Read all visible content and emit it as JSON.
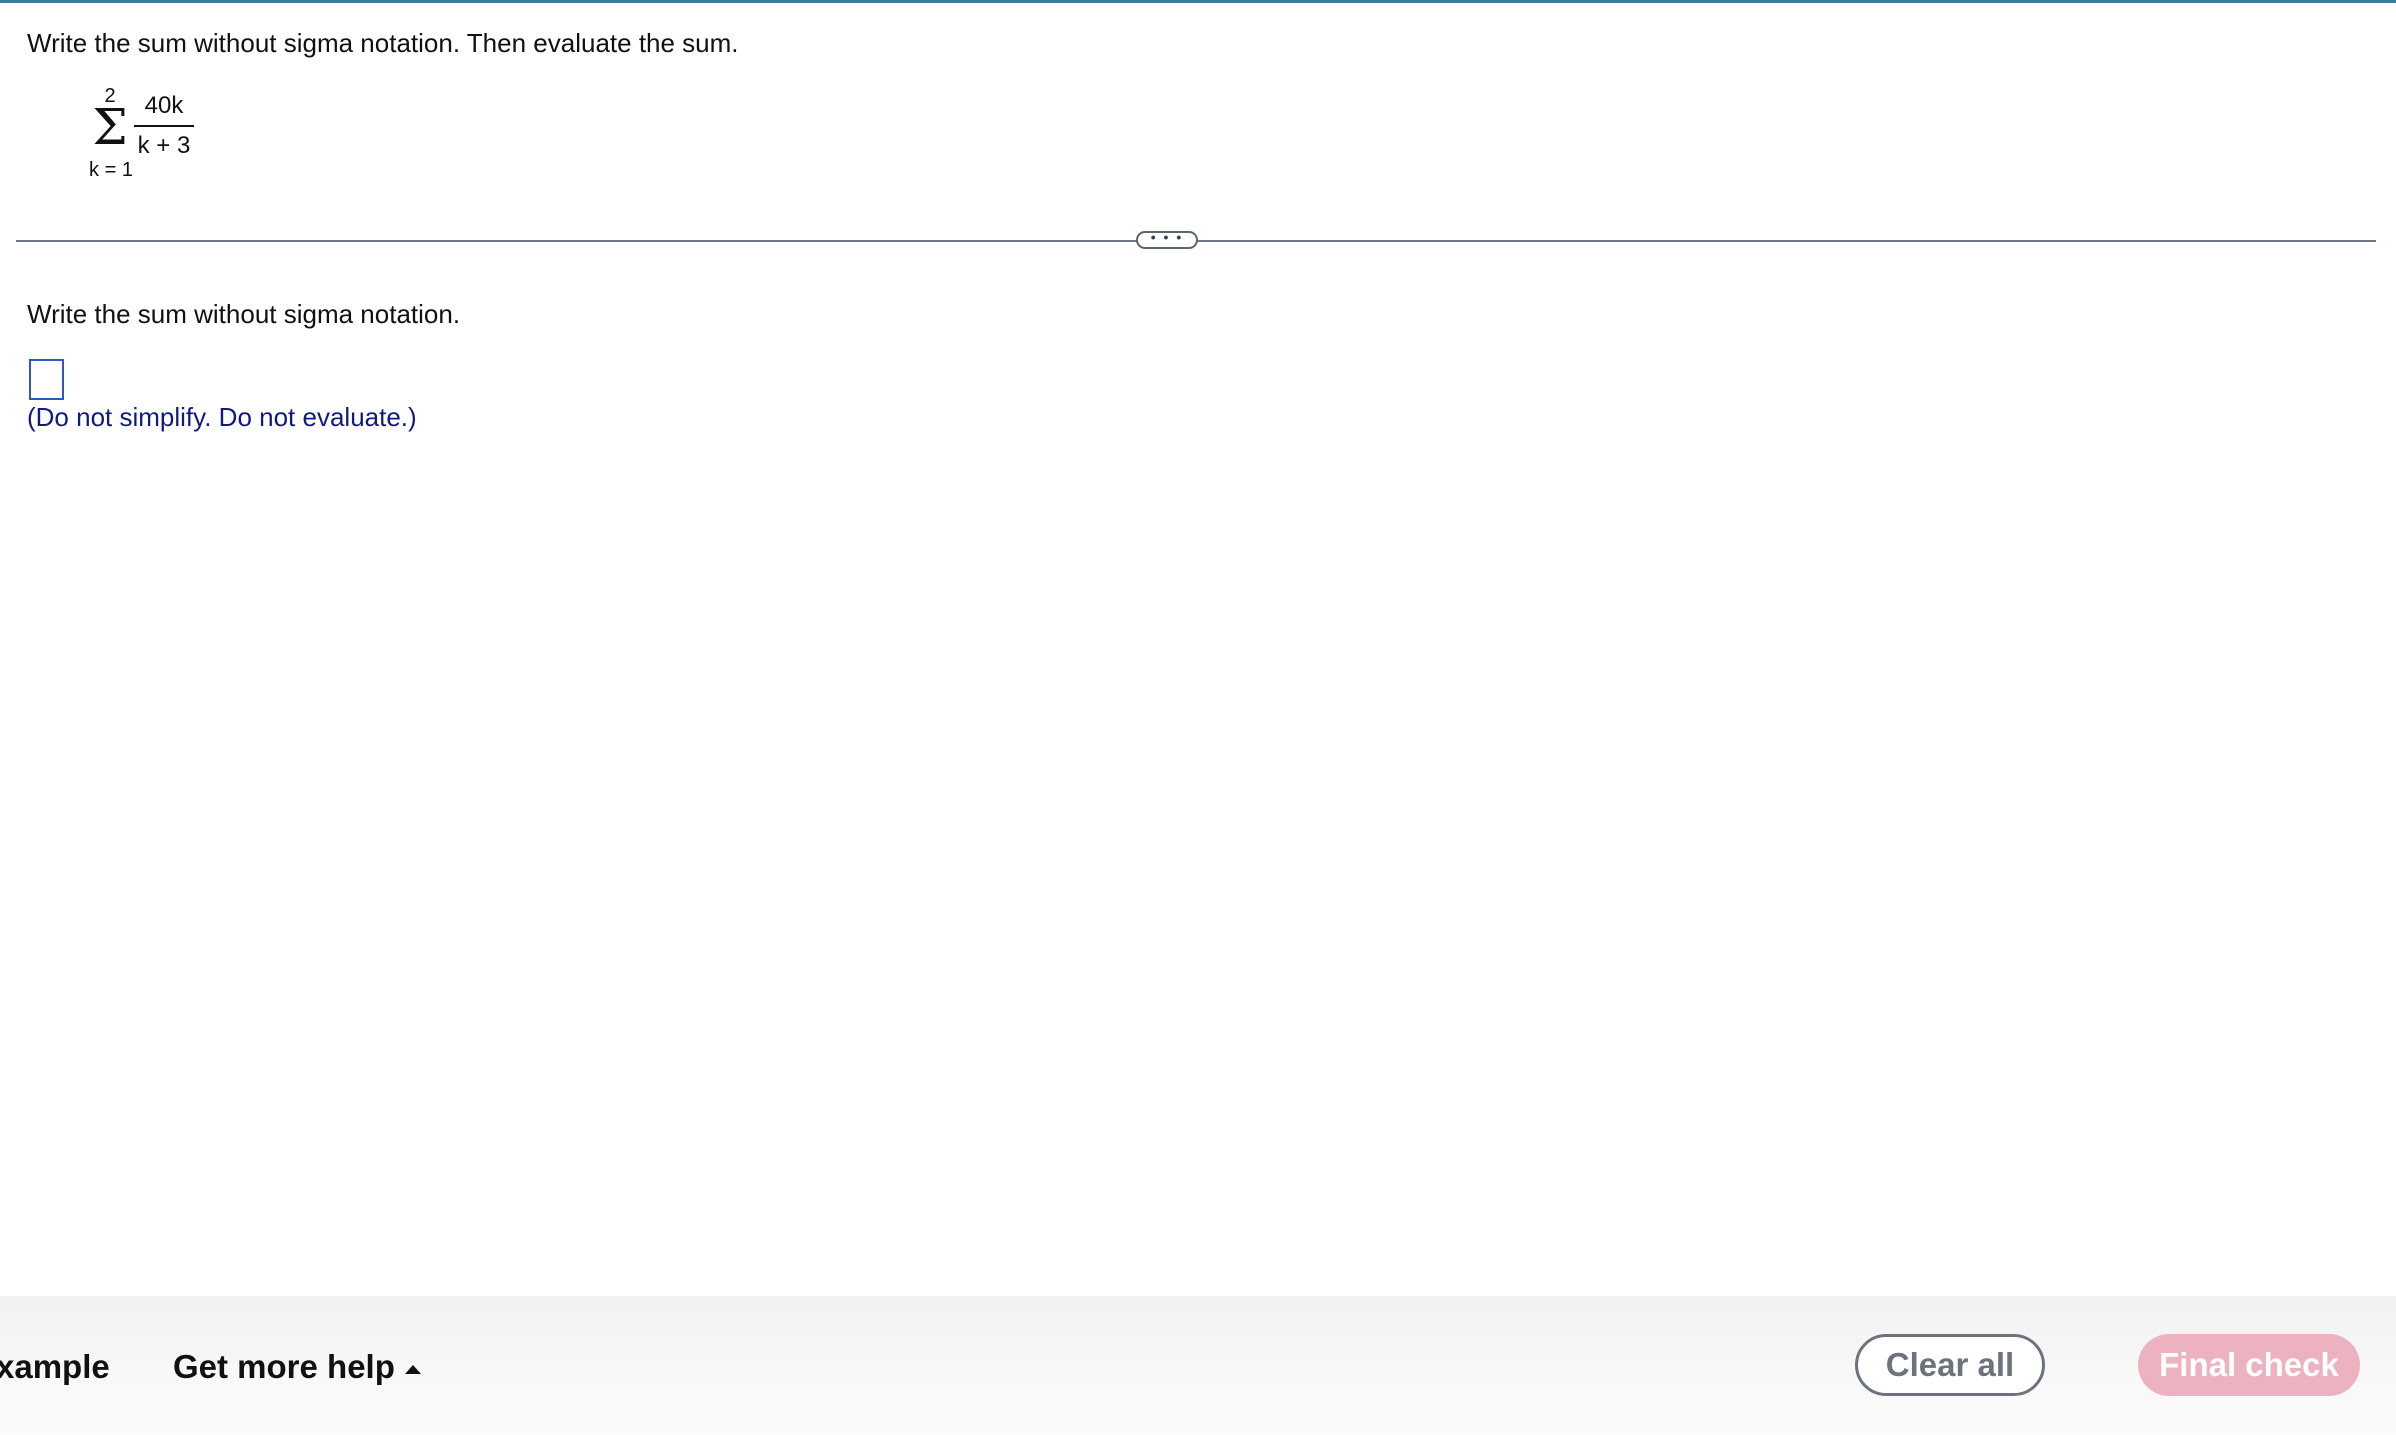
{
  "question": {
    "instruction": "Write the sum without sigma notation. Then evaluate the sum.",
    "sigma": {
      "symbol": "Σ",
      "upper_limit": "2",
      "lower_limit": "k = 1",
      "numerator": "40k",
      "denominator": "k + 3"
    }
  },
  "divider": {
    "expand_label": "• • •"
  },
  "answer": {
    "prompt": "Write the sum without sigma notation.",
    "input_value": "",
    "hint": "(Do not simplify. Do not evaluate.)"
  },
  "footer": {
    "example_label": "xample",
    "help_label": "Get more help",
    "help_icon": "caret-up-icon",
    "clear_label": "Clear all",
    "check_label": "Final check"
  },
  "colors": {
    "accent_top": "#3d7a96",
    "hint_text": "#111a80",
    "input_border": "#2f56c2",
    "final_check_bg": "#edb2bf",
    "clear_border": "#6c737d"
  }
}
